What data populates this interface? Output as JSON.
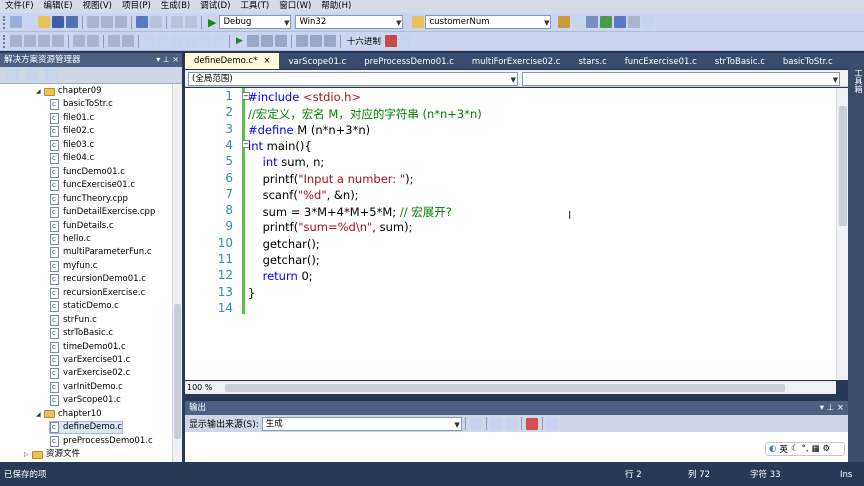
{
  "menu": [
    "文件(F)",
    "编辑(E)",
    "视图(V)",
    "项目(P)",
    "生成(B)",
    "调试(D)",
    "工具(T)",
    "窗口(W)",
    "帮助(H)"
  ],
  "toolbar": {
    "config": "Debug",
    "platform": "Win32",
    "find_value": "customerNum",
    "hex_label": "十六进制"
  },
  "solution_explorer": {
    "title": "解决方案资源管理器",
    "items": [
      {
        "label": "chapter09",
        "type": "folder",
        "level": 1
      },
      {
        "label": "basicToStr.c",
        "type": "file",
        "level": 2
      },
      {
        "label": "file01.c",
        "type": "file",
        "level": 2
      },
      {
        "label": "file02.c",
        "type": "file",
        "level": 2
      },
      {
        "label": "file03.c",
        "type": "file",
        "level": 2
      },
      {
        "label": "file04.c",
        "type": "file",
        "level": 2
      },
      {
        "label": "funcDemo01.c",
        "type": "file",
        "level": 2
      },
      {
        "label": "funcExercise01.c",
        "type": "file",
        "level": 2
      },
      {
        "label": "funcTheory.cpp",
        "type": "file",
        "level": 2
      },
      {
        "label": "funDetailExercise.cpp",
        "type": "file",
        "level": 2
      },
      {
        "label": "funDetails.c",
        "type": "file",
        "level": 2
      },
      {
        "label": "hello.c",
        "type": "file",
        "level": 2
      },
      {
        "label": "multiParameterFun.c",
        "type": "file",
        "level": 2
      },
      {
        "label": "myfun.c",
        "type": "file",
        "level": 2
      },
      {
        "label": "recursionDemo01.c",
        "type": "file",
        "level": 2
      },
      {
        "label": "recursionExercise.c",
        "type": "file",
        "level": 2
      },
      {
        "label": "staticDemo.c",
        "type": "file",
        "level": 2
      },
      {
        "label": "strFun.c",
        "type": "file",
        "level": 2
      },
      {
        "label": "strToBasic.c",
        "type": "file",
        "level": 2
      },
      {
        "label": "timeDemo01.c",
        "type": "file",
        "level": 2
      },
      {
        "label": "varExercise01.c",
        "type": "file",
        "level": 2
      },
      {
        "label": "varExercise02.c",
        "type": "file",
        "level": 2
      },
      {
        "label": "varInitDemo.c",
        "type": "file",
        "level": 2
      },
      {
        "label": "varScope01.c",
        "type": "file",
        "level": 2
      },
      {
        "label": "chapter10",
        "type": "folder",
        "level": 1
      },
      {
        "label": "defineDemo.c",
        "type": "file",
        "level": 2,
        "selected": true
      },
      {
        "label": "preProcessDemo01.c",
        "type": "file",
        "level": 2
      },
      {
        "label": "资源文件",
        "type": "folder",
        "level": 0
      }
    ]
  },
  "tabs": [
    {
      "label": "defineDemo.c*",
      "active": true
    },
    {
      "label": "varScope01.c"
    },
    {
      "label": "preProcessDemo01.c"
    },
    {
      "label": "multiForExercise02.c"
    },
    {
      "label": "stars.c"
    },
    {
      "label": "funcExercise01.c"
    },
    {
      "label": "strToBasic.c"
    },
    {
      "label": "basicToStr.c"
    }
  ],
  "scope": "(全局范围)",
  "code_lines": [
    {
      "n": "1",
      "html": "<span class='kw'>#include</span> <span class='str'>&lt;stdio.h&gt;</span>"
    },
    {
      "n": "2",
      "html": "<span class='cm'>//宏定义，宏名 M，对应的字符串 (n*n+3*n)</span>"
    },
    {
      "n": "3",
      "html": "<span class='kw'>#define</span> M (n*n+3*n)"
    },
    {
      "n": "4",
      "html": "<span class='kw'>int</span> main(){"
    },
    {
      "n": "5",
      "html": "    <span class='kw'>int</span> sum, n;"
    },
    {
      "n": "6",
      "html": "    printf(<span class='str'>\"Input a number: \"</span>);"
    },
    {
      "n": "7",
      "html": "    scanf(<span class='str'>\"%d\"</span>, &amp;n);"
    },
    {
      "n": "8",
      "html": "    sum = 3*M+4*M+5*M; <span class='cm'>// 宏展开?</span>"
    },
    {
      "n": "9",
      "html": "    printf(<span class='str'>\"sum=%d\\n\"</span>, sum);"
    },
    {
      "n": "10",
      "html": "    getchar();"
    },
    {
      "n": "11",
      "html": "    getchar();"
    },
    {
      "n": "12",
      "html": "    <span class='kw'>return</span> 0;"
    },
    {
      "n": "13",
      "html": "}"
    },
    {
      "n": "14",
      "html": ""
    }
  ],
  "zoom": "100 %",
  "toolbox_title": "工具箱",
  "output": {
    "title": "输出",
    "source_label": "显示输出来源(S):",
    "source_value": "生成"
  },
  "ime": {
    "label": "英"
  },
  "status": {
    "left": "已保存的项",
    "row": "行 2",
    "col": "列 72",
    "char": "字符 33",
    "mode": "Ins"
  },
  "colors": {
    "keyword": "#0000ff",
    "string": "#a31515",
    "comment": "#008000",
    "line_number": "#2b91af",
    "chrome": "#293955"
  }
}
